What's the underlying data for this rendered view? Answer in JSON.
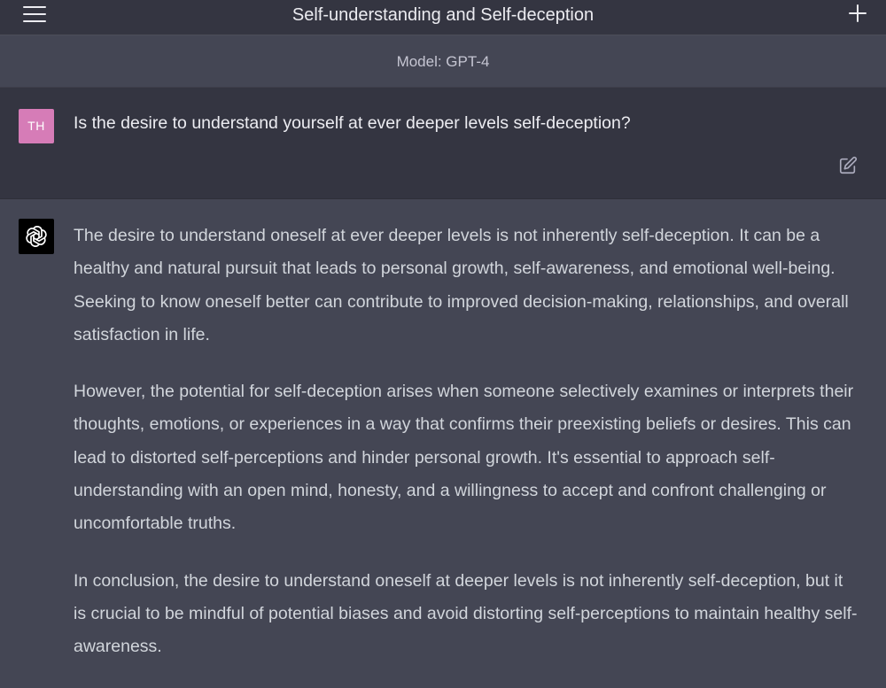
{
  "header": {
    "title": "Self-understanding and Self-deception",
    "menu_icon": "hamburger-menu-icon",
    "new_chat_icon": "plus-icon"
  },
  "model_bar": {
    "label": "Model: GPT-4"
  },
  "user_message": {
    "avatar_initials": "TH",
    "avatar_color": "#d67cb7",
    "text": "Is the desire to understand yourself at ever deeper levels self-deception?",
    "edit_icon": "edit-icon"
  },
  "assistant_message": {
    "avatar_icon": "openai-logo-icon",
    "paragraphs": [
      "The desire to understand oneself at ever deeper levels is not inherently self-deception. It can be a healthy and natural pursuit that leads to personal growth, self-awareness, and emotional well-being. Seeking to know oneself better can contribute to improved decision-making, relationships, and overall satisfaction in life.",
      "However, the potential for self-deception arises when someone selectively examines or interprets their thoughts, emotions, or experiences in a way that confirms their preexisting beliefs or desires. This can lead to distorted self-perceptions and hinder personal growth. It's essential to approach self-understanding with an open mind, honesty, and a willingness to accept and confront challenging or uncomfortable truths.",
      "In conclusion, the desire to understand oneself at deeper levels is not inherently self-deception, but it is crucial to be mindful of potential biases and avoid distorting self-perceptions to maintain healthy self-awareness."
    ]
  },
  "colors": {
    "header_bg": "#343541",
    "user_bg": "#343541",
    "assistant_bg": "#444654",
    "text": "#ececf1"
  }
}
